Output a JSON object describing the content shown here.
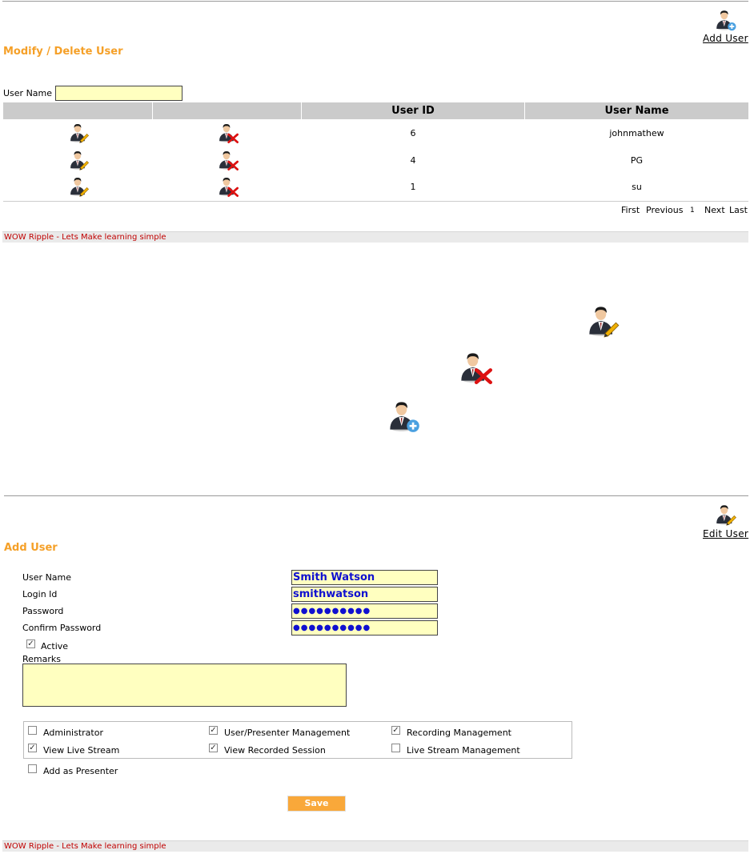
{
  "modify": {
    "title": "Modify / Delete User",
    "add_user_link": "Add User",
    "username_label": "User Name",
    "username_value": "",
    "columns": [
      "",
      "",
      "User ID",
      "User Name"
    ],
    "rows": [
      {
        "id": "6",
        "name": "johnmathew"
      },
      {
        "id": "4",
        "name": "PG"
      },
      {
        "id": "1",
        "name": "su"
      }
    ],
    "pager": {
      "first": "First",
      "previous": "Previous",
      "page": "1",
      "next": "Next",
      "last": "Last"
    }
  },
  "footer": {
    "top": "WOW Ripple - Lets Make learning simple",
    "bottom": "WOW Ripple - Lets Make learning simple"
  },
  "add": {
    "title": "Add User",
    "edit_user_link": "Edit User",
    "fields": {
      "username_label": "User Name",
      "username_value": "Smith Watson",
      "login_label": "Login Id",
      "login_value": "smithwatson",
      "password_label": "Password",
      "password_value": "●●●●●●●●●●",
      "confirm_label": "Confirm Password",
      "confirm_value": "●●●●●●●●●●"
    },
    "active_label": "Active",
    "active_checked": true,
    "remarks_label": "Remarks",
    "remarks_value": "",
    "permissions": [
      {
        "label": "Administrator",
        "checked": false
      },
      {
        "label": "User/Presenter Management",
        "checked": true
      },
      {
        "label": "Recording Management",
        "checked": true
      },
      {
        "label": "View Live Stream",
        "checked": true
      },
      {
        "label": "View Recorded Session",
        "checked": true
      },
      {
        "label": "Live Stream Management",
        "checked": false
      }
    ],
    "presenter_label": "Add as Presenter",
    "presenter_checked": false,
    "save_label": "Save"
  },
  "icons": {
    "edit": "user-edit-icon",
    "delete": "user-delete-icon",
    "add": "user-add-icon"
  },
  "colors": {
    "title": "#f5a028",
    "field_bg": "#ffffc0",
    "field_text": "#1010d0",
    "footer_text": "#c00000",
    "save_bg": "#f9a83a"
  }
}
